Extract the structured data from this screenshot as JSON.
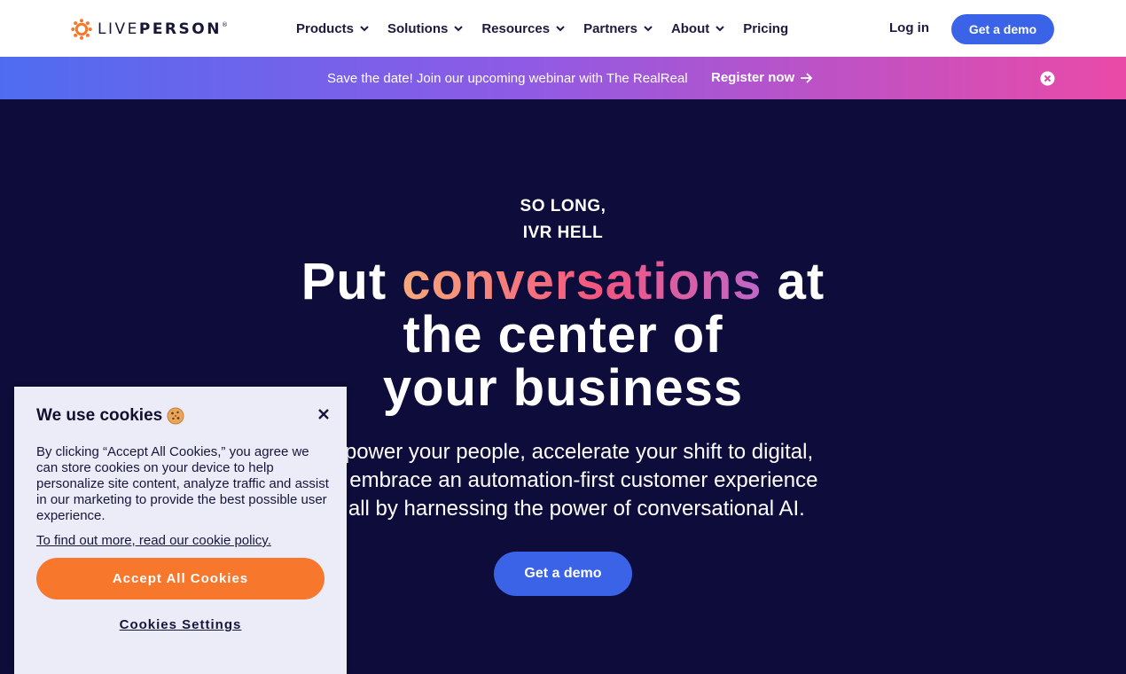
{
  "header": {
    "brand": {
      "light": "LIVE",
      "bold": "PERSON",
      "mark": "®"
    },
    "nav": [
      {
        "label": "Products"
      },
      {
        "label": "Solutions"
      },
      {
        "label": "Resources"
      },
      {
        "label": "Partners"
      },
      {
        "label": "About"
      }
    ],
    "pricing_label": "Pricing",
    "login_label": "Log in",
    "demo_label": "Get a demo"
  },
  "banner": {
    "text": "Save the date! Join our upcoming webinar with The RealReal",
    "link_label": "Register now"
  },
  "hero": {
    "eyebrow_line1": "SO LONG,",
    "eyebrow_line2": "IVR HELL",
    "headline_before": "Put ",
    "headline_highlight": "conversations",
    "headline_after_line1": " at",
    "headline_line2": "the center of",
    "headline_line3": "your business",
    "subtext_line1": "Empower your people, accelerate your shift to digital,",
    "subtext_line2": "and embrace an automation-first customer experience",
    "subtext_line3": "— all by harnessing the power of conversational AI.",
    "cta_label": "Get a demo"
  },
  "cookie_banner": {
    "title": "We use cookies",
    "body": "By clicking “Accept All Cookies,” you agree we can store cookies on your device to help personalize site content, analyze traffic and assist in our marketing to provide the best possible user experience.",
    "policy_link": "To find out more, read our cookie policy.",
    "accept_label": "Accept All Cookies",
    "settings_label": "Cookies Settings"
  },
  "colors": {
    "brand_orange": "#f7782d",
    "primary_blue": "#3a63e8",
    "hero_bg": "#0d0c3a",
    "banner_gradient_start": "#4f6cf0",
    "banner_gradient_end": "#ea4aa7"
  },
  "icons": {
    "logo": "sun-logo-icon",
    "nav_chevron": "chevron-down-icon",
    "banner_arrow": "arrow-right-icon",
    "banner_close": "circle-close-icon",
    "cookie_emoji": "cookie-icon",
    "cookie_close": "close-icon"
  }
}
